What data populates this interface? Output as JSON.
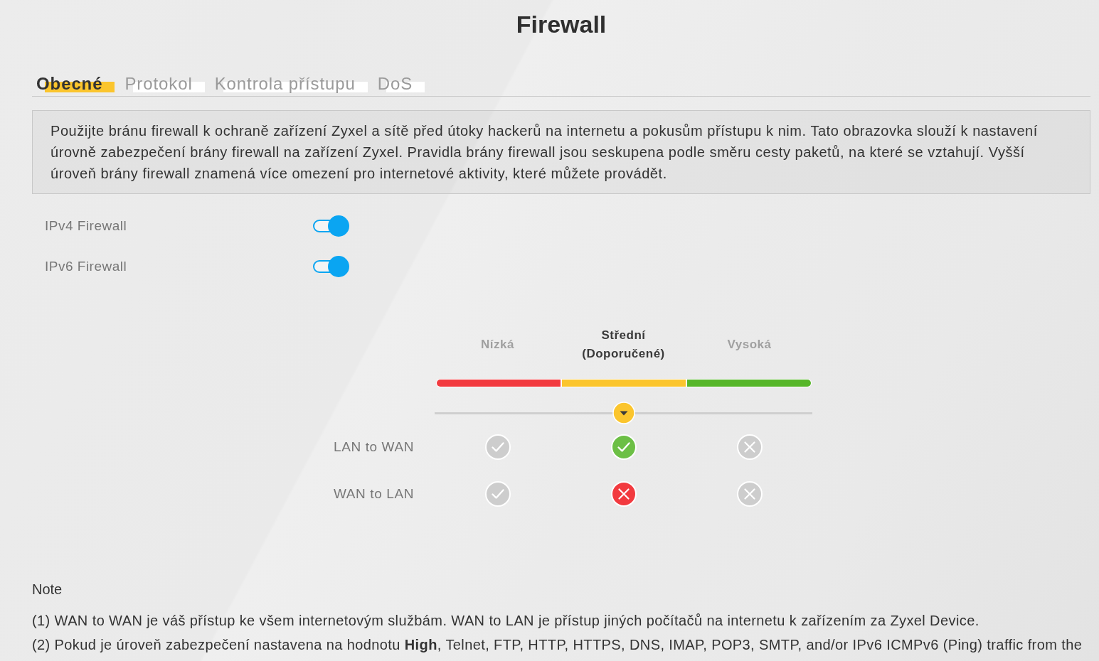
{
  "title": "Firewall",
  "tabs": [
    {
      "label": "Obecné",
      "selected": true
    },
    {
      "label": "Protokol",
      "selected": false
    },
    {
      "label": "Kontrola přístupu",
      "selected": false
    },
    {
      "label": "DoS",
      "selected": false
    }
  ],
  "description": "Použijte bránu firewall k ochraně zařízení Zyxel a sítě před útoky hackerů na internetu a pokusům přístupu k nim. Tato obrazovka slouží k nastavení úrovně zabezpečení brány firewall na zařízení Zyxel. Pravidla brány firewall jsou seskupena podle směru cesty paketů, na které se vztahují. Vyšší úroveň brány firewall znamená více omezení pro internetové aktivity, které můžete provádět.",
  "toggles": [
    {
      "label": "IPv4 Firewall",
      "on": true
    },
    {
      "label": "IPv6 Firewall",
      "on": true
    }
  ],
  "security_level": {
    "levels": [
      {
        "label": "Nízká",
        "selected": false,
        "color": "#f23a3f"
      },
      {
        "label": "Střední (Doporučené)",
        "selected": true,
        "color": "#fbc52d"
      },
      {
        "label": "Vysoká",
        "selected": false,
        "color": "#56b629"
      }
    ],
    "slider": {
      "level": 0.5
    },
    "rules": [
      {
        "label": "LAN to WAN",
        "cells": [
          {
            "kind": "check"
          },
          {
            "kind": "check"
          },
          {
            "kind": "cross"
          }
        ]
      },
      {
        "label": "WAN to LAN",
        "cells": [
          {
            "kind": "check"
          },
          {
            "kind": "cross"
          },
          {
            "kind": "cross"
          }
        ]
      }
    ]
  },
  "note": {
    "title": "Note",
    "lines": [
      "(1) WAN to WAN je váš přístup ke všem internetovým službám. WAN to LAN je přístup jiných počítačů na internetu k zařízením za Zyxel Device.",
      "(2) Pokud je úroveň zabezpečení nastavena na hodnotu **High**, Telnet, FTP, HTTP, HTTPS, DNS, IMAP, POP3, SMTP, and/or IPv6 ICMPv6 (Ping) traffic from the"
    ]
  }
}
